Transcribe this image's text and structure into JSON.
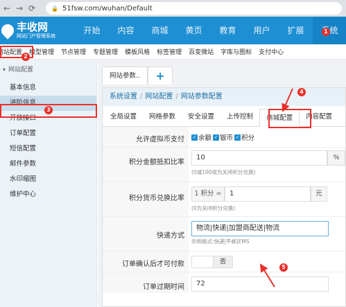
{
  "browser": {
    "url": "51fsw.com/wuhan/Default"
  },
  "header": {
    "brand_name": "丰收网",
    "brand_sub": "网站门户管理系统",
    "nav": [
      "开始",
      "内容",
      "商城",
      "黄页",
      "教育",
      "用户",
      "扩展",
      "系统"
    ]
  },
  "subnav": [
    "网站配置",
    "模型管理",
    "节点管理",
    "专题管理",
    "模板风格",
    "标签管理",
    "百变微站",
    "字库与图标",
    "支付中心"
  ],
  "sidebar": {
    "section": "网站配置",
    "items": [
      "基本信息",
      "进阶信息",
      "开放接口",
      "订单配置",
      "短信配置",
      "邮件参数",
      "水印缩图",
      "维护中心"
    ]
  },
  "frame_tabs": {
    "current": "网站参数..",
    "add": "+"
  },
  "breadcrumb": [
    "系统设置",
    "网站配置",
    "网站参数配置"
  ],
  "config_tabs": [
    "全局设置",
    "网格参数",
    "安全设置",
    "上传控制",
    "商城配置",
    "内容配置"
  ],
  "form": {
    "virtual_currency": {
      "label": "允许虚拟币支付",
      "options": [
        "余额",
        "银币",
        "积分"
      ]
    },
    "points_deduct": {
      "label": "积分金额抵扣比率",
      "value": "10",
      "suffix": "%",
      "hint": "(0或100视为关闭积分兑换)"
    },
    "points_exchange": {
      "label": "积分货币兑换比率",
      "prefix": "1 积分 =",
      "value": "1",
      "suffix": "元",
      "hint": "(0为关闭积分兑换)"
    },
    "delivery": {
      "label": "快递方式",
      "value": "物流|快递|加盟商配送|物流",
      "hint": "示例格式:快递|平邮|EMS"
    },
    "confirm_pay": {
      "label": "订单确认后才可付款",
      "toggle_no": "否"
    },
    "order_expire": {
      "label": "订单过期时间",
      "value": "72"
    }
  },
  "annotations": [
    "1",
    "2",
    "3",
    "4",
    "5"
  ],
  "colors": {
    "primary": "#1e8fd3",
    "annotation": "#e8302a"
  }
}
